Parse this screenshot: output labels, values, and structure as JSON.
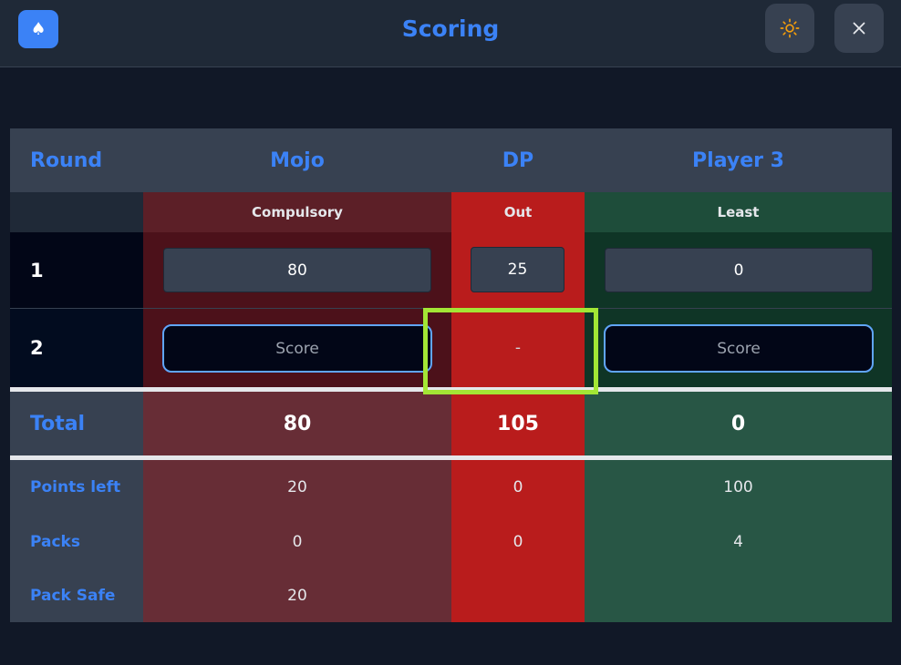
{
  "header": {
    "title": "Scoring",
    "logo_icon": "spade-icon",
    "theme_icon": "sun-icon",
    "close_icon": "close-icon"
  },
  "table": {
    "round_header": "Round",
    "players": [
      {
        "name": "Mojo",
        "status": "Compulsory",
        "color": "#b91c1c"
      },
      {
        "name": "DP",
        "status": "Out",
        "color": "#b91c1c"
      },
      {
        "name": "Player 3",
        "status": "Least",
        "color": "#15803d"
      }
    ],
    "rounds": [
      {
        "label": "1",
        "scores": [
          "80",
          "25",
          "0"
        ]
      },
      {
        "label": "2",
        "placeholders": [
          "Score",
          "Score"
        ],
        "dp_value": "-"
      }
    ],
    "total": {
      "label": "Total",
      "values": [
        "80",
        "105",
        "0"
      ]
    },
    "stats": [
      {
        "label": "Points left",
        "values": [
          "20",
          "0",
          "100"
        ]
      },
      {
        "label": "Packs",
        "values": [
          "0",
          "0",
          "4"
        ]
      },
      {
        "label": "Pack Safe",
        "values": [
          "20",
          "",
          ""
        ]
      }
    ]
  },
  "colors": {
    "accent": "#3b82f6",
    "out_red": "#b91c1c",
    "highlight": "#a3e635"
  }
}
